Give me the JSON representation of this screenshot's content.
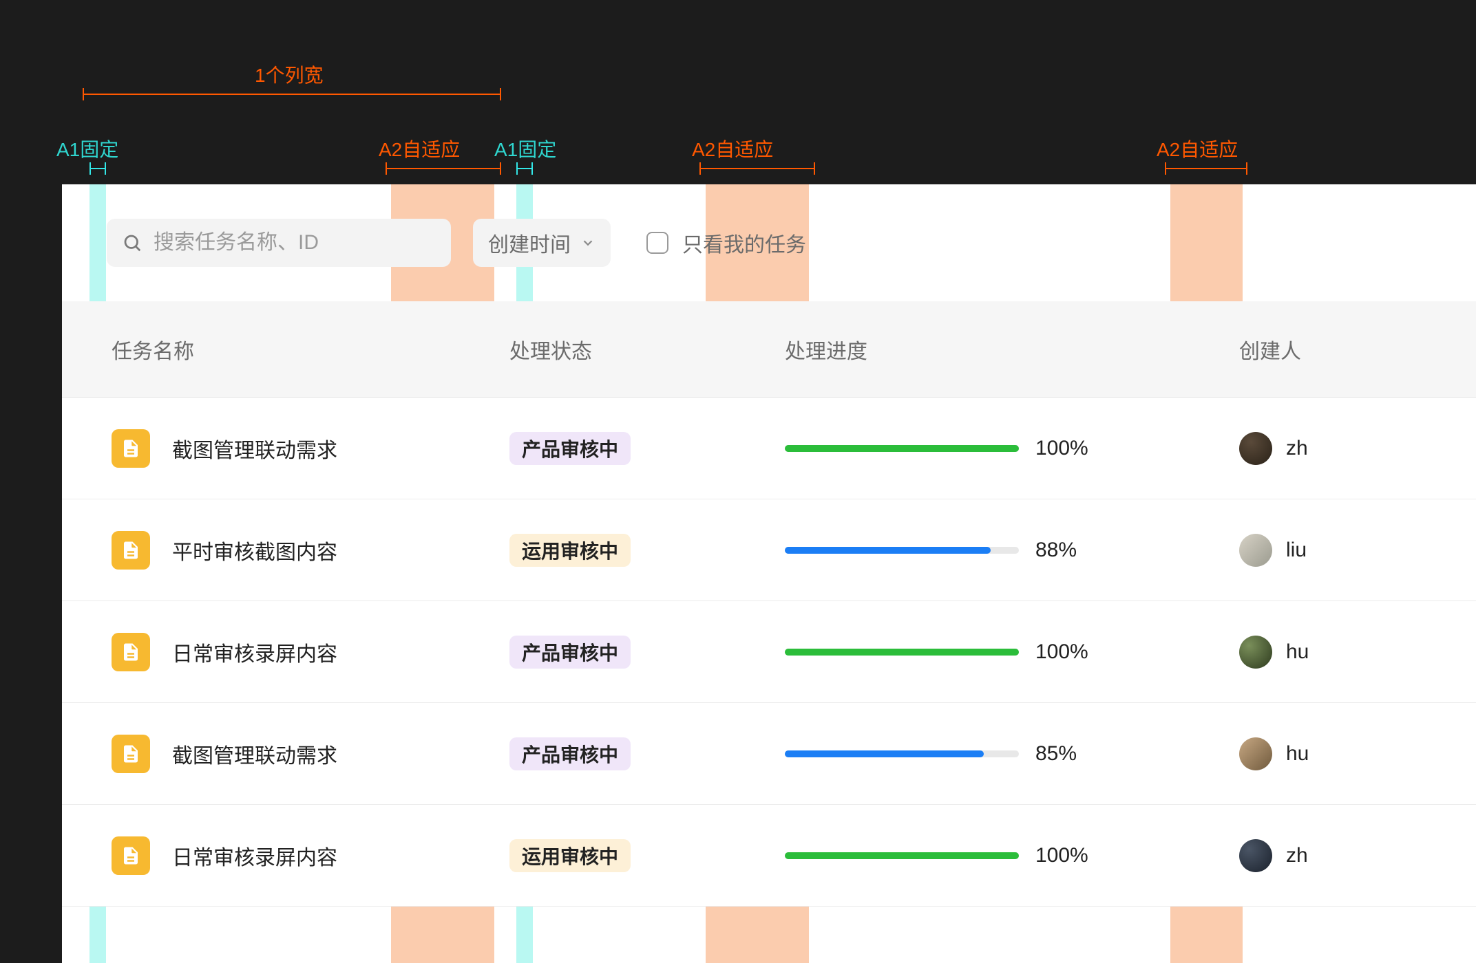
{
  "annotations": {
    "col_width_label": "1个列宽",
    "a1_fixed": "A1固定",
    "a2_adaptive": "A2自适应"
  },
  "toolbar": {
    "search_placeholder": "搜索任务名称、ID",
    "sort_label": "创建时间",
    "filter_checkbox_label": "只看我的任务"
  },
  "columns": {
    "name": "任务名称",
    "status": "处理状态",
    "progress": "处理进度",
    "creator": "创建人"
  },
  "status_styles": {
    "产品审核中": "purple",
    "运用审核中": "amber"
  },
  "rows": [
    {
      "title": "截图管理联动需求",
      "status": "产品审核中",
      "progress_pct": 100,
      "progress_color": "green",
      "creator": "zh",
      "avatar_class": "a1"
    },
    {
      "title": "平时审核截图内容",
      "status": "运用审核中",
      "progress_pct": 88,
      "progress_color": "blue",
      "creator": "liu",
      "avatar_class": "a2"
    },
    {
      "title": "日常审核录屏内容",
      "status": "产品审核中",
      "progress_pct": 100,
      "progress_color": "green",
      "creator": "hu",
      "avatar_class": "a3"
    },
    {
      "title": "截图管理联动需求",
      "status": "产品审核中",
      "progress_pct": 85,
      "progress_color": "blue",
      "creator": "hu",
      "avatar_class": "a4"
    },
    {
      "title": "日常审核录屏内容",
      "status": "运用审核中",
      "progress_pct": 100,
      "progress_color": "green",
      "creator": "zh",
      "avatar_class": "a5"
    }
  ],
  "colors": {
    "accent_orange": "#ff5800",
    "accent_cyan": "#2fd6cf",
    "status_purple_bg": "#f0e6f9",
    "status_amber_bg": "#fdf0d7",
    "progress_green": "#2bbd3a",
    "progress_blue": "#1b7ef5",
    "doc_icon_bg": "#f7b930"
  }
}
